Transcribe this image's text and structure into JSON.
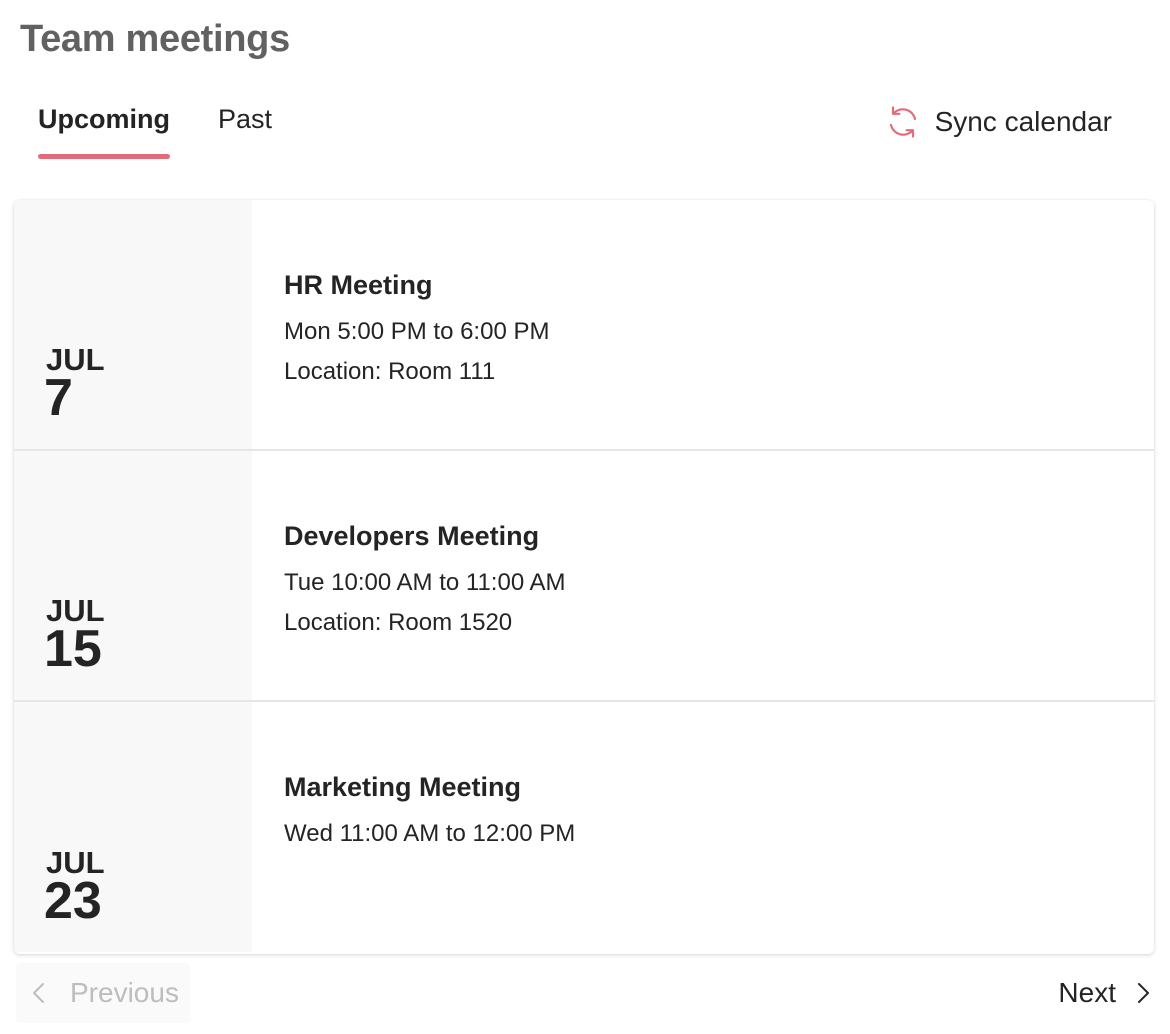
{
  "page": {
    "title": "Team meetings"
  },
  "tabs": [
    {
      "label": "Upcoming",
      "active": true
    },
    {
      "label": "Past",
      "active": false
    }
  ],
  "sync": {
    "label": "Sync calendar",
    "icon": "sync-icon",
    "icon_color": "#e36b7b"
  },
  "meetings": [
    {
      "month": "JUL",
      "day": "7",
      "title": "HR Meeting",
      "time": "Mon 5:00 PM to 6:00 PM",
      "location": "Location: Room 111"
    },
    {
      "month": "JUL",
      "day": "15",
      "title": "Developers Meeting",
      "time": "Tue 10:00 AM to 11:00 AM",
      "location": "Location: Room 1520"
    },
    {
      "month": "JUL",
      "day": "23",
      "title": "Marketing Meeting",
      "time": "Wed 11:00 AM to 12:00 PM",
      "location": ""
    }
  ],
  "pagination": {
    "previous_label": "Previous",
    "previous_disabled": true,
    "next_label": "Next"
  },
  "colors": {
    "accent": "#e36b7b",
    "text": "#242424",
    "title": "#616161",
    "disabled": "#bdbdbd"
  }
}
